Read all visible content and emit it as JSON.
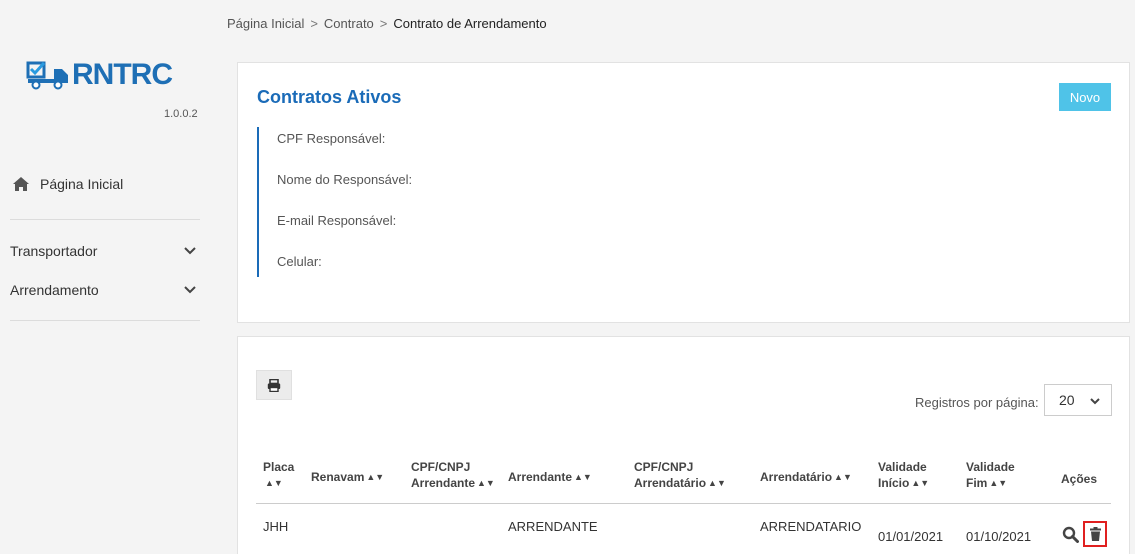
{
  "sidebar": {
    "logo_text": "RNTRC",
    "version": "1.0.0.2",
    "home_label": "Página Inicial",
    "items": [
      {
        "label": "Transportador"
      },
      {
        "label": "Arrendamento"
      }
    ]
  },
  "breadcrumb": {
    "items": [
      "Página Inicial",
      "Contrato",
      "Contrato de Arrendamento"
    ],
    "separator": ">"
  },
  "contracts_panel": {
    "title": "Contratos Ativos",
    "new_button": "Novo",
    "fields": [
      "CPF Responsável:",
      "Nome do Responsável:",
      "E-mail Responsável:",
      "Celular:"
    ]
  },
  "table_panel": {
    "per_page_label": "Registros por página:",
    "per_page_value": "20",
    "columns": [
      {
        "line1": "Placa",
        "line2": "",
        "sort": true
      },
      {
        "line1": "Renavam",
        "line2": "",
        "sort": true
      },
      {
        "line1": "CPF/CNPJ",
        "line2": "Arrendante",
        "sort": true
      },
      {
        "line1": "Arrendante",
        "line2": "",
        "sort": true
      },
      {
        "line1": "CPF/CNPJ",
        "line2": "Arrendatário",
        "sort": true
      },
      {
        "line1": "Arrendatário",
        "line2": "",
        "sort": true
      },
      {
        "line1": "Validade",
        "line2": "Início",
        "sort": true
      },
      {
        "line1": "Validade",
        "line2": "Fim",
        "sort": true
      },
      {
        "line1": "Ações",
        "line2": "",
        "sort": false
      }
    ],
    "rows": [
      {
        "placa": "JHH",
        "renavam": "",
        "cpf_arrendante": "",
        "arrendante": "ARRENDANTE",
        "cpf_arrendatario": "",
        "arrendatario": "ARRENDATARIO",
        "inicio": "01/01/2021",
        "fim": "01/10/2021"
      }
    ]
  },
  "colors": {
    "brand": "#1a6bb8",
    "novo": "#4fc3e8",
    "highlight": "#e02020"
  },
  "icons": [
    "truck-check-icon",
    "home-icon",
    "chevron-down-icon",
    "print-icon",
    "search-icon",
    "trash-icon"
  ]
}
